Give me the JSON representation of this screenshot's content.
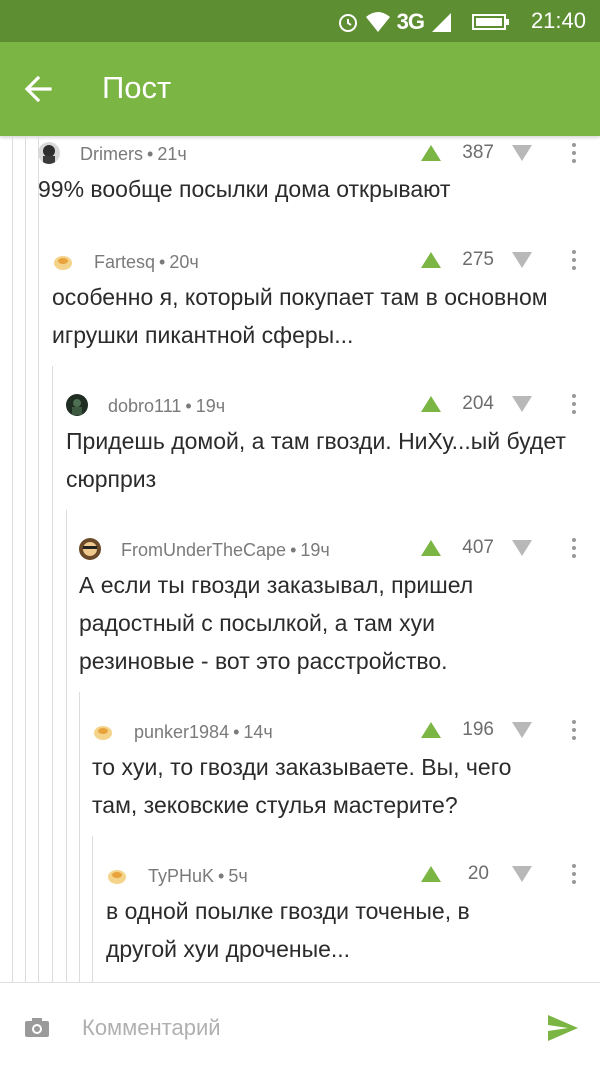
{
  "status_bar": {
    "network": "3G",
    "time": "21:40"
  },
  "app_bar": {
    "title": "Пост"
  },
  "comments": [
    {
      "author": "Drimers",
      "time": "21ч",
      "rating": "387",
      "text": "99% вообще посылки дома открывают"
    },
    {
      "author": "Fartesq",
      "time": "20ч",
      "rating": "275",
      "text": "особенно я, который покупает там в основном игрушки пикантной сферы..."
    },
    {
      "author": "dobro111",
      "time": "19ч",
      "rating": "204",
      "text": "Придешь домой, а там гвозди. НиХу...ый будет сюрприз"
    },
    {
      "author": "FromUnderTheCape",
      "time": "19ч",
      "rating": "407",
      "text": "А если ты гвозди заказывал, пришел радостный с посылкой, а там хуи резиновые - вот это расстройство."
    },
    {
      "author": "punker1984",
      "time": "14ч",
      "rating": "196",
      "text": "то хуи, то гвозди заказываете. Вы, чего там, зековские стулья мастерите?"
    },
    {
      "author": "TyPHuK",
      "time": "5ч",
      "rating": "20",
      "text": "в одной поылке гвозди точеные, в другой хуи дроченые..."
    }
  ],
  "composer": {
    "placeholder": "Комментарий"
  },
  "colors": {
    "appbar": "#7bb543",
    "statusbar": "#5d8e32",
    "upvote": "#7bb543",
    "downvote": "#b8b8b8",
    "send": "#7bb543"
  },
  "icons": [
    "back-arrow-icon",
    "camera-icon",
    "send-icon",
    "upvote-icon",
    "downvote-icon",
    "more-icon"
  ]
}
